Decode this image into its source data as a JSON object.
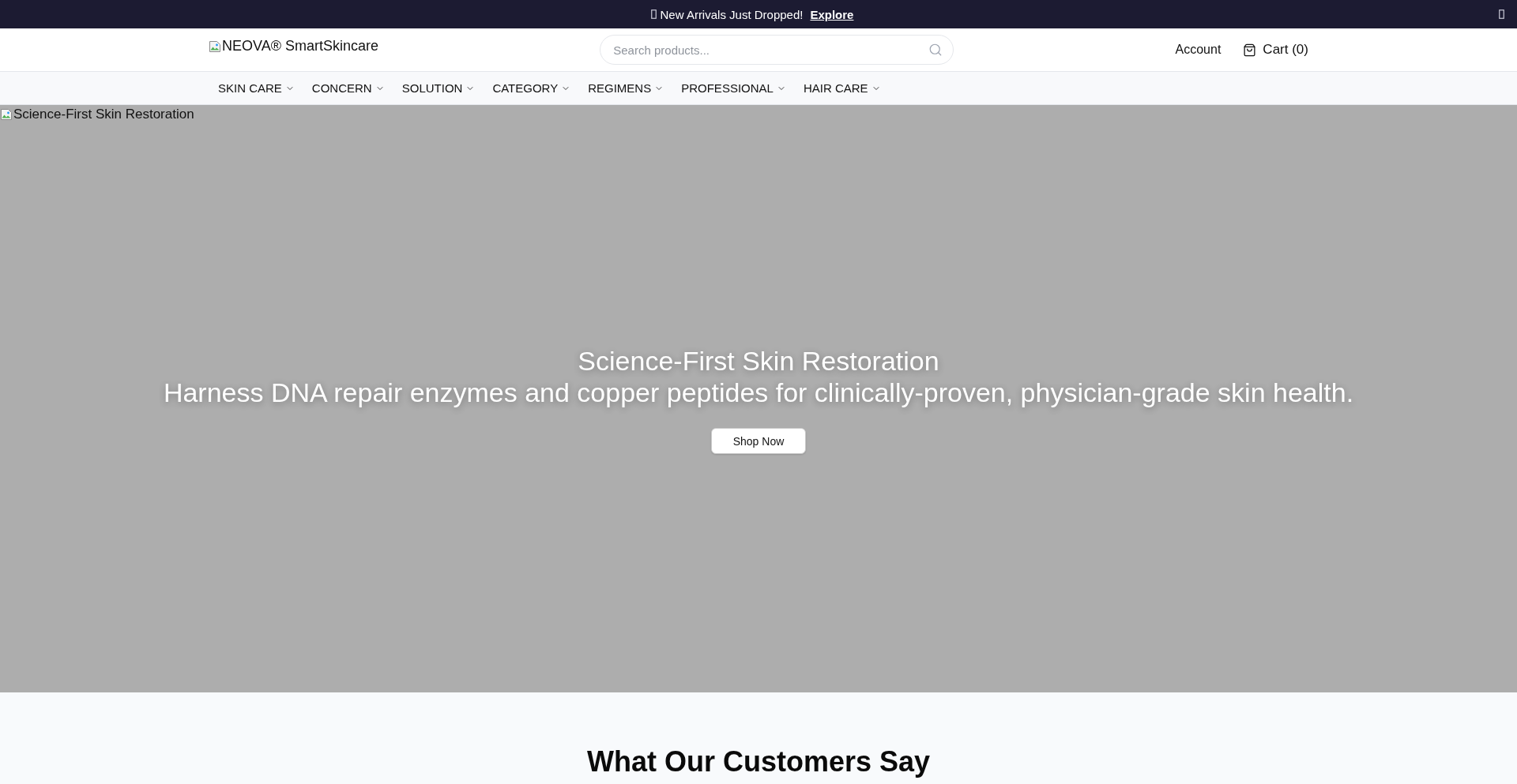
{
  "announcement": {
    "text": "New Arrivals Just Dropped!",
    "link": "Explore"
  },
  "header": {
    "logo_alt": "NEOVA® SmartSkincare",
    "search": {
      "placeholder": "Search products..."
    },
    "account": "Account",
    "cart": "Cart (0)"
  },
  "nav": {
    "items": [
      {
        "label": "SKIN CARE"
      },
      {
        "label": "CONCERN"
      },
      {
        "label": "SOLUTION"
      },
      {
        "label": "CATEGORY"
      },
      {
        "label": "REGIMENS"
      },
      {
        "label": "PROFESSIONAL"
      },
      {
        "label": "HAIR CARE"
      }
    ]
  },
  "hero": {
    "image_alt": "Science-First Skin Restoration",
    "title": "Science-First Skin Restoration",
    "subtitle": "Harness DNA repair enzymes and copper peptides for clinically-proven, physician-grade skin health.",
    "button": "Shop Now"
  },
  "testimonials": {
    "heading": "What Our Customers Say"
  }
}
